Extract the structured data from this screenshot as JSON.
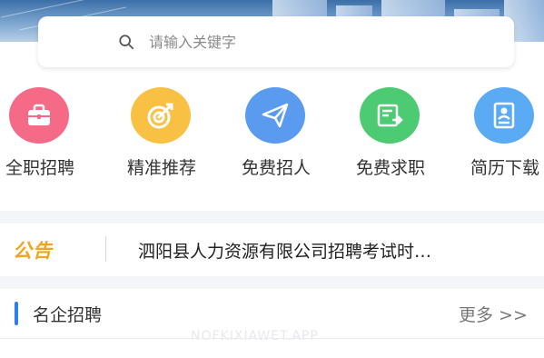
{
  "search": {
    "placeholder": "请输入关键字"
  },
  "categories": [
    {
      "label": "全职招聘",
      "icon": "briefcase-icon",
      "color": "#f56b87"
    },
    {
      "label": "精准推荐",
      "icon": "target-icon",
      "color": "#f8c144"
    },
    {
      "label": "免费招人",
      "icon": "paper-plane-icon",
      "color": "#5a9bf0"
    },
    {
      "label": "免费求职",
      "icon": "form-icon",
      "color": "#4dcb73"
    },
    {
      "label": "简历下载",
      "icon": "resume-icon",
      "color": "#5aaaf4"
    }
  ],
  "notice": {
    "tag": "公告",
    "text": "泗阳县人力资源有限公司招聘考试时…"
  },
  "section": {
    "title": "名企招聘",
    "more": "更多 >>"
  },
  "watermark": "NOFKIXIAWET.APP",
  "colors": {
    "accent": "#2f7ef0",
    "notice_tag": "#f3a41d"
  }
}
